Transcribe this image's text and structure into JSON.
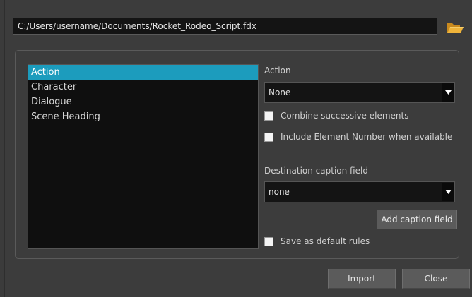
{
  "file": {
    "path": "C:/Users/username/Documents/Rocket_Rodeo_Script.fdx",
    "browse_icon": "folder-open-icon"
  },
  "elements": {
    "items": [
      {
        "label": "Action",
        "selected": true
      },
      {
        "label": "Character",
        "selected": false
      },
      {
        "label": "Dialogue",
        "selected": false
      },
      {
        "label": "Scene Heading",
        "selected": false
      }
    ]
  },
  "action": {
    "label": "Action",
    "selected_value": "None",
    "combine_label": "Combine successive elements",
    "combine_checked": false,
    "include_number_label": "Include Element Number when available",
    "include_number_checked": false
  },
  "destination": {
    "label": "Destination caption field",
    "selected_value": "none",
    "add_button_label": "Add caption field"
  },
  "save_default": {
    "label": "Save as default rules",
    "checked": false
  },
  "buttons": {
    "import_label": "Import",
    "close_label": "Close"
  },
  "colors": {
    "selection": "#1c9cbd",
    "background": "#3c3c3c",
    "field": "#141414"
  }
}
